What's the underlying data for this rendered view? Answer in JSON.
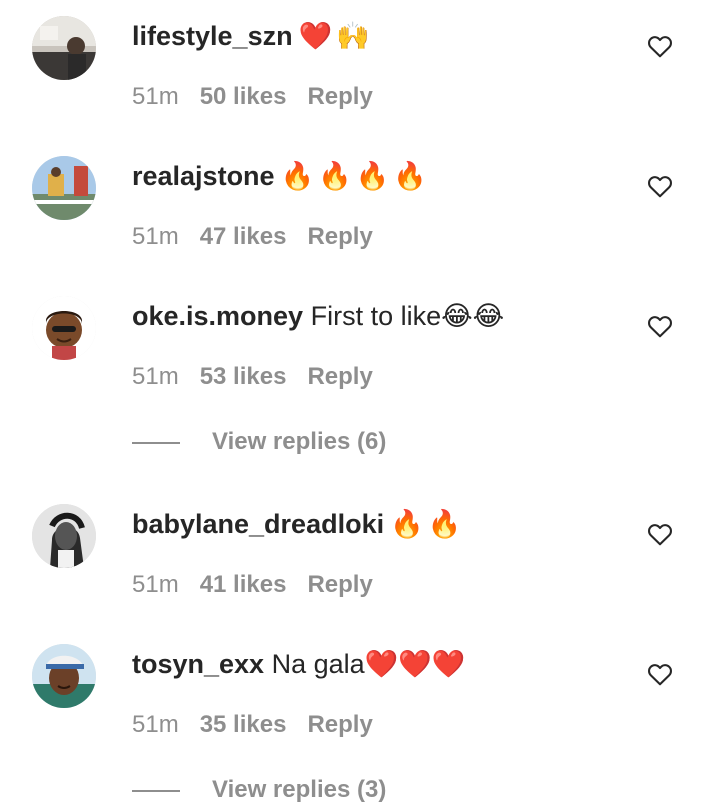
{
  "comments": [
    {
      "username": "lifestyle_szn",
      "text": "",
      "emoji": "❤️🙌",
      "time": "51m",
      "likes": "50 likes",
      "reply": "Reply",
      "avatar_icon": "photo-room-avatar"
    },
    {
      "username": "realajstone",
      "text": "",
      "emoji": "🔥🔥🔥🔥",
      "time": "51m",
      "likes": "47 likes",
      "reply": "Reply",
      "avatar_icon": "photo-outdoor-avatar"
    },
    {
      "username": "oke.is.money",
      "text": "First to like",
      "emoji": "😂😂",
      "time": "51m",
      "likes": "53 likes",
      "reply": "Reply",
      "avatar_icon": "memoji-avatar",
      "view_replies": "View replies (6)"
    },
    {
      "username": "babylane_dreadloki",
      "text": "",
      "emoji": "🔥🔥",
      "time": "51m",
      "likes": "41 likes",
      "reply": "Reply",
      "avatar_icon": "bw-portrait-avatar"
    },
    {
      "username": "tosyn_exx",
      "text": "Na gala",
      "emoji": "❤️❤️❤️",
      "time": "51m",
      "likes": "35 likes",
      "reply": "Reply",
      "avatar_icon": "selfie-avatar",
      "view_replies": "View replies (3)"
    }
  ],
  "colors": {
    "text": "#262626",
    "meta": "#8e8e8e",
    "background": "#ffffff"
  }
}
